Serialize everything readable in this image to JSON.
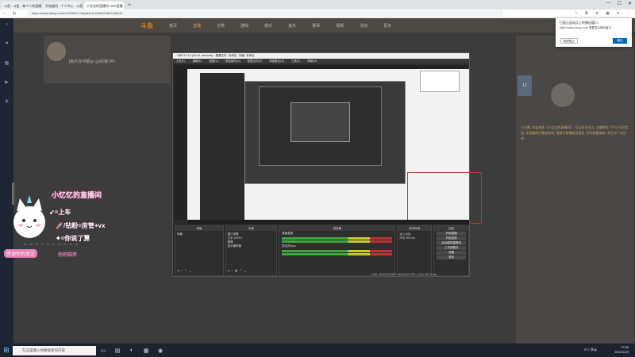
{
  "browser": {
    "tabs": [
      {
        "label": "斗鱼 - 斗鱼 - 每个人的直播平台"
      },
      {
        "label": "开始使用 - 个人中心 - 斗鱼"
      },
      {
        "label": "小北北的直播间 OBS直播 - 斗鱼"
      }
    ],
    "new_tab": "+",
    "url": "https://www.douyu.com/11209971?dyshid=0-a70e6726d7c40d1f"
  },
  "site": {
    "logo": "斗鱼",
    "nav": [
      "首页",
      "直播",
      "分类",
      "游戏",
      "娱乐",
      "鱼乐",
      "赛事",
      "视频",
      "活动",
      "更多"
    ],
    "streamer_title": "[每天好叫都go go的第1帅~",
    "right_badge": "12",
    "right_text": "小主播, 欢迎来到【小北北的直播间】, 可以多多关注, 主播将在下午与大家相见, 本直播间内播放游戏, 请遵守直播相关规定, 祝你观看愉快, 有空点个关注吧~",
    "left_icons": [
      "首页",
      "关注",
      "分类",
      "直播",
      "游戏"
    ]
  },
  "popup": {
    "heading": "已阻止此站点上的弹出窗口",
    "body": "https://www.douyu.com 想要显示弹出窗口",
    "btn_secondary": "始终阻止",
    "btn_primary": "确定"
  },
  "overlay": {
    "title": "小忆忆的直播间",
    "line1": "=上车",
    "line2": "/钻粉=房管+vx",
    "line3": "=你说了算",
    "dash": "~ ~ ~ ~ ~ ~ ~ ~ ~ ~",
    "pink_label": "感谢你的关注",
    "pink_label2": "你的陪伴"
  },
  "obs": {
    "title": "OBS 27.2.4 (64-bit, windows) - 配置文件: 未命名 - 场景: 未命名",
    "menu": [
      "文件(F)",
      "编辑(E)",
      "视图(V)",
      "停靠部件(D)",
      "配置文件(P)",
      "场景集合(S)",
      "工具(T)",
      "帮助(H)"
    ],
    "docks": {
      "scenes": {
        "header": "场景",
        "items": [
          "场景"
        ]
      },
      "sources": {
        "header": "来源",
        "items": [
          "窗口采集",
          "文本 (GDI+)",
          "图像",
          "显示器采集"
        ]
      },
      "mixer": {
        "header": "混音器",
        "rows": [
          "桌面音频",
          "麦克风/Aux"
        ]
      },
      "transitions": {
        "header": "转场特效",
        "value": "淡入淡出",
        "duration_label": "时长",
        "duration": "300 ms"
      },
      "controls": {
        "header": "控制",
        "buttons": [
          "开始直播",
          "开始录制",
          "启动虚拟摄像机",
          "工作室模式",
          "设置",
          "退出"
        ]
      }
    },
    "status": "LIVE: 00:00:00    REC: 00:00:00    CPU: 3.2%, 30.00 fps"
  },
  "taskbar": {
    "search_placeholder": "在这里输入你要搜索的内容",
    "time": "17:56",
    "date": "2022/1/20",
    "tray_text": "6°C 多云"
  }
}
